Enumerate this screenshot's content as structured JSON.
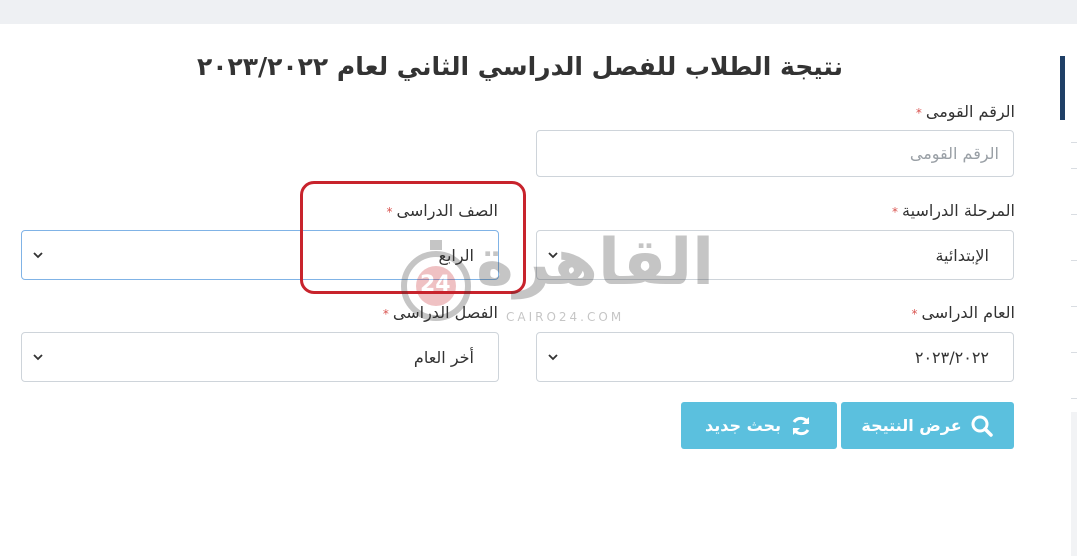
{
  "page": {
    "title": "نتيجة الطلاب للفصل الدراسي الثاني لعام ٢٠٢٣/٢٠٢٢"
  },
  "form": {
    "national_id": {
      "label": "الرقم القومى",
      "required_mark": "*",
      "placeholder": "الرقم القومى"
    },
    "stage": {
      "label": "المرحلة الدراسية",
      "required_mark": "*",
      "value": "الإبتدائية"
    },
    "grade": {
      "label": "الصف الدراسى",
      "required_mark": "*",
      "value": "الرابع"
    },
    "year": {
      "label": "العام الدراسى",
      "required_mark": "*",
      "value": "٢٠٢٣/٢٠٢٢"
    },
    "term": {
      "label": "الفصل الدراسى",
      "required_mark": "*",
      "value": "أخر العام"
    }
  },
  "buttons": {
    "show_result": {
      "label": "عرض النتيجة",
      "icon": "search-icon"
    },
    "new_search": {
      "label": "بحث جديد",
      "icon": "refresh-icon"
    }
  },
  "watermark": {
    "logo_text": "القاهرة",
    "badge": "24",
    "sub_text": "CAIRO24.COM"
  },
  "colors": {
    "button_bg": "#5bc0de",
    "required": "#d9534f",
    "highlight": "#c8232c",
    "sidebar_accent": "#1f3f66"
  }
}
